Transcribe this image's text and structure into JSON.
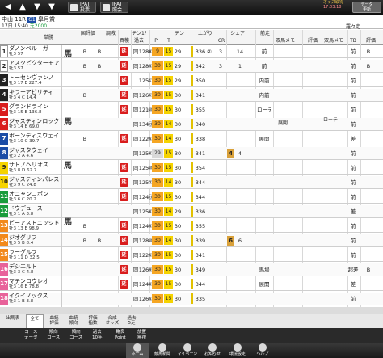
{
  "top": {
    "ipat1": "IPAT\n投票",
    "ipat2": "IPAT\n照会",
    "odds_time": "オッズ取得",
    "odds_time2": "17:03:18",
    "update_btn": "データ\n更新"
  },
  "race": {
    "venue": "中山",
    "race_no": "11R",
    "grade": "G1",
    "race_name": "皐月賞",
    "date": "17日",
    "time": "15:40",
    "course": "芝2000",
    "weather": "晴/良"
  },
  "headers": {
    "num": "",
    "tansho": "単勝",
    "uma": "馬",
    "kokuhyo": "国評価",
    "chokyo": "調教",
    "kaishi": "買穫",
    "tm": "TM",
    "tenif": "テン1F",
    "kako": "過去",
    "ten_f": "上F",
    "p": "P",
    "t": "T",
    "ten": "テン",
    "agari": "上がり",
    "cr": "CR",
    "share": "シェア",
    "zenso": "前走",
    "memo1": "双馬メモ",
    "hyoka": "評価",
    "memo2": "双馬メモ",
    "tb": "TB",
    "hyoka2": "評価",
    "ruiuma": "羅々走"
  },
  "horses": [
    {
      "num": "1",
      "color": "#ffffff",
      "fg": "#222",
      "name": "ダノンベルーガ",
      "sub": "牡3  57",
      "odds": "5.7",
      "rank": "1",
      "k1": "B",
      "k2": "B",
      "enc": "延",
      "kako": "同",
      "f": "128",
      "r1": "⑧",
      "r2": "9",
      "p": "29",
      "yel": "15",
      "agari": "336",
      "ag_r": "②",
      "cr": "3",
      "sh": "14",
      "zen": "前",
      "tb": "前",
      "h2": "B"
    },
    {
      "num": "2",
      "color": "#ffffff",
      "fg": "#222",
      "name": "アスクビクターモア",
      "sub": "牡3  57",
      "odds": "",
      "rank": "",
      "k1": "B",
      "k2": "B",
      "enc": "延",
      "kako": "同",
      "f": "128",
      "r1": "⑤",
      "r2": "30",
      "p": "29",
      "yel": "15",
      "agari": "342",
      "ag_r": "",
      "cr": "3",
      "sh": "1",
      "zen": "前",
      "tb": "前",
      "h2": "B"
    },
    {
      "num": "3",
      "color": "#222222",
      "fg": "#fff",
      "name": "トーセンヴァンノ",
      "sub": "牡3  17  E  227.4",
      "odds": "",
      "rank": "",
      "k1": "",
      "k2": "",
      "enc": "延",
      "kako": "",
      "f": "125",
      "r1": "①",
      "r2": "30",
      "p": "29",
      "yel": "15",
      "agari": "350",
      "ag_r": "",
      "cr": "",
      "sh": "",
      "zen": "内前",
      "tb": "前",
      "h2": ""
    },
    {
      "num": "4",
      "color": "#222222",
      "fg": "#fff",
      "name": "キラーアビリティ",
      "sub": "牡3  4  C  14.4",
      "odds": "",
      "rank": "",
      "k1": "B",
      "k2": "",
      "enc": "延",
      "kako": "同",
      "f": "126",
      "r1": "①",
      "r2": "30",
      "p": "30",
      "yel": "15",
      "agari": "341",
      "ag_r": "",
      "cr": "",
      "sh": "",
      "zen": "内前",
      "tb": "前",
      "h2": ""
    },
    {
      "num": "5",
      "color": "#d91c1c",
      "fg": "#fff",
      "name": "グランドライン",
      "sub": "牡3  15  E  136.8",
      "odds": "",
      "rank": "",
      "k1": "",
      "k2": "",
      "enc": "延",
      "kako": "同",
      "f": "121",
      "r1": "⑩",
      "r2": "30",
      "p": "30",
      "yel": "15",
      "agari": "355",
      "ag_r": "",
      "cr": "",
      "sh": "",
      "zen": "ローテ",
      "tb": "前",
      "h2": ""
    },
    {
      "num": "6",
      "color": "#d91c1c",
      "fg": "#fff",
      "name": "ジャスティンロック",
      "sub": "牡3  14  B  69.0",
      "odds": "",
      "rank": "",
      "k1": "",
      "k2": "",
      "enc": "none",
      "kako": "同",
      "f": "134",
      "r1": "⑬",
      "r2": "30",
      "p": "30",
      "yel": "14",
      "agari": "340",
      "ag_r": "",
      "cr": "",
      "sh": "",
      "zen": "",
      "tb": "前",
      "h2": ""
    },
    {
      "num": "7",
      "color": "#1c4da6",
      "fg": "#fff",
      "name": "ボーンディスウェイ",
      "sub": "牡3  10  C  39.7",
      "odds": "",
      "rank": "",
      "k1": "B",
      "k2": "",
      "enc": "延",
      "kako": "同",
      "f": "122",
      "r1": "⑤",
      "r2": "30",
      "p": "30",
      "yel": "14",
      "agari": "338",
      "ag_r": "",
      "cr": "",
      "sh": "",
      "zen": "展開",
      "tb": "差",
      "h2": ""
    },
    {
      "num": "8",
      "color": "#1c4da6",
      "fg": "#fff",
      "name": "ジャスタウェイ",
      "sub": "牡3  2  A  4.6",
      "odds": "",
      "rank": "",
      "k1": "",
      "k2": "",
      "enc": "none",
      "kako": "同",
      "f": "125",
      "r1": "⑥",
      "r2": "29",
      "p": "30",
      "yel": "15",
      "agari": "341",
      "ag_r": "",
      "cr": "",
      "sh": "4",
      "zen": "",
      "tb": "前",
      "h2": ""
    },
    {
      "num": "9",
      "color": "#f5d300",
      "fg": "#222",
      "name": "サトノヘリオス",
      "sub": "牡3  8  D  62.7",
      "odds": "",
      "rank": "",
      "k1": "",
      "k2": "",
      "enc": "延",
      "kako": "同",
      "f": "125",
      "r1": "⑩",
      "r2": "30",
      "p": "30",
      "yel": "15",
      "agari": "354",
      "ag_r": "",
      "cr": "",
      "sh": "",
      "zen": "",
      "tb": "前",
      "h2": ""
    },
    {
      "num": "10",
      "color": "#f5d300",
      "fg": "#222",
      "name": "ジャスティンパレス",
      "sub": "牡3  9  C  24.8",
      "odds": "",
      "rank": "",
      "k1": "",
      "k2": "",
      "enc": "延",
      "kako": "同",
      "f": "125",
      "r1": "②",
      "r2": "30",
      "p": "30",
      "yel": "14",
      "agari": "344",
      "ag_r": "",
      "cr": "",
      "sh": "",
      "zen": "",
      "tb": "前",
      "h2": ""
    },
    {
      "num": "11",
      "color": "#1a9c3c",
      "fg": "#fff",
      "name": "オニャンコポン",
      "sub": "牡3  6  C  20.2",
      "odds": "",
      "rank": "",
      "k1": "",
      "k2": "",
      "enc": "延",
      "kako": "同",
      "f": "124",
      "r1": "⑬",
      "r2": "30",
      "p": "30",
      "yel": "15",
      "agari": "344",
      "ag_r": "",
      "cr": "",
      "sh": "",
      "zen": "",
      "tb": "前",
      "h2": ""
    },
    {
      "num": "12",
      "color": "#1a9c3c",
      "fg": "#fff",
      "name": "ドウデュース",
      "sub": "牡3  1  A  3.8",
      "odds": "",
      "rank": "",
      "k1": "",
      "k2": "",
      "enc": "none",
      "kako": "同",
      "f": "125",
      "r1": "⑥",
      "r2": "30",
      "p": "29",
      "yel": "14",
      "agari": "336",
      "ag_r": "",
      "cr": "",
      "sh": "",
      "zen": "",
      "tb": "差",
      "h2": ""
    },
    {
      "num": "13",
      "color": "#f28a1c",
      "fg": "#fff",
      "name": "ビーアストニッシド",
      "sub": "牡3  13  E  98.9",
      "odds": "",
      "rank": "",
      "k1": "B",
      "k2": "",
      "enc": "延",
      "kako": "同",
      "f": "124",
      "r1": "⑤",
      "r2": "30",
      "p": "30",
      "yel": "15",
      "agari": "355",
      "ag_r": "",
      "cr": "",
      "sh": "",
      "zen": "",
      "tb": "前",
      "h2": ""
    },
    {
      "num": "14",
      "color": "#f28a1c",
      "fg": "#fff",
      "name": "ジオグリフ",
      "sub": "牡3  5  B  8.4",
      "odds": "",
      "rank": "",
      "k1": "B",
      "k2": "B",
      "enc": "延",
      "kako": "同",
      "f": "128",
      "r1": "⑩",
      "r2": "30",
      "p": "30",
      "yel": "14",
      "agari": "339",
      "ag_r": "",
      "cr": "",
      "sh": "6",
      "zen": "",
      "tb": "前",
      "h2": ""
    },
    {
      "num": "15",
      "color": "#f28a1c",
      "fg": "#fff",
      "name": "ラーグルフ",
      "sub": "牡3  11  D  32.5",
      "odds": "",
      "rank": "",
      "k1": "",
      "k2": "",
      "enc": "延",
      "kako": "同",
      "f": "122",
      "r1": "⑤",
      "r2": "30",
      "p": "30",
      "yel": "15",
      "agari": "341",
      "ag_r": "",
      "cr": "",
      "sh": "",
      "zen": "",
      "tb": "前",
      "h2": ""
    },
    {
      "num": "16",
      "color": "#e8629a",
      "fg": "#fff",
      "name": "デシエルト",
      "sub": "牡3  3  C  4.8",
      "odds": "",
      "rank": "",
      "k1": "",
      "k2": "",
      "enc": "延",
      "kako": "同",
      "f": "126",
      "r1": "⑨",
      "r2": "30",
      "p": "30",
      "yel": "15",
      "agari": "349",
      "ag_r": "",
      "cr": "",
      "sh": "",
      "zen": "馬場",
      "tb": "超差",
      "h2": "B"
    },
    {
      "num": "17",
      "color": "#e8629a",
      "fg": "#fff",
      "name": "マテンロウレオ",
      "sub": "牡3  16  E  78.8",
      "odds": "",
      "rank": "",
      "k1": "",
      "k2": "",
      "enc": "延",
      "kako": "同",
      "f": "124",
      "r1": "⑥",
      "r2": "30",
      "p": "30",
      "yel": "15",
      "agari": "344",
      "ag_r": "",
      "cr": "",
      "sh": "",
      "zen": "展開",
      "tb": "差",
      "h2": ""
    },
    {
      "num": "18",
      "color": "#e8629a",
      "fg": "#fff",
      "name": "イクイノックス",
      "sub": "牡3  1  B  3.8",
      "odds": "",
      "rank": "",
      "k1": "",
      "k2": "",
      "enc": "none",
      "kako": "同",
      "f": "126",
      "r1": "⑤",
      "r2": "30",
      "p": "30",
      "yel": "15",
      "agari": "335",
      "ag_r": "",
      "cr": "",
      "sh": "",
      "zen": "",
      "tb": "前",
      "h2": ""
    }
  ],
  "memo_col": {
    "memo1": "展開",
    "memo2": "ローテ"
  },
  "uma_label": "馬",
  "tabs": [
    {
      "label": "出馬表",
      "on": false
    },
    {
      "label": "全て",
      "on": true
    },
    {
      "label": "血統\n評価",
      "on": false
    },
    {
      "label": "血統\n傾向",
      "on": false
    },
    {
      "label": "評価\n指数",
      "on": false
    },
    {
      "label": "合成\nオッズ",
      "on": false
    },
    {
      "label": "過去\n5走",
      "on": false
    }
  ],
  "bottom_bar": [
    {
      "label": "コース\nデータ"
    },
    {
      "label": "傾向\nコース"
    },
    {
      "label": "傾向\nコース"
    },
    {
      "label": "過去\n10年"
    },
    {
      "label": "亀良\nPoint"
    },
    {
      "label": "放置\n無視"
    }
  ],
  "footer": [
    {
      "label": "ホーム",
      "on": true
    },
    {
      "label": "競馬新聞",
      "on": false
    },
    {
      "label": "マイページ",
      "on": false
    },
    {
      "label": "お知らせ",
      "on": false
    },
    {
      "label": "環境設定",
      "on": false
    },
    {
      "label": "ヘルプ",
      "on": false
    }
  ]
}
